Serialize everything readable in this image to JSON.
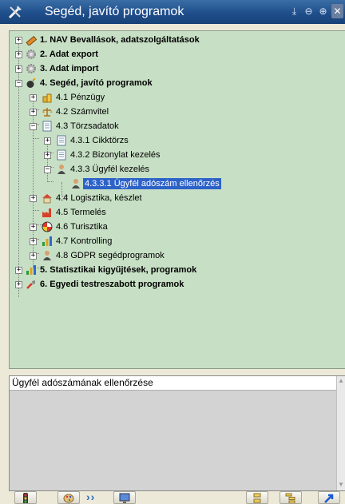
{
  "window": {
    "title": "Segéd, javító programok"
  },
  "tree": {
    "items": [
      {
        "label": "1. NAV Bevallások, adatszolgáltatások",
        "icon": "pen-icon"
      },
      {
        "label": "2. Adat export",
        "icon": "gear-icon"
      },
      {
        "label": "3. Adat import",
        "icon": "gear-icon"
      },
      {
        "label": "4. Segéd, javító programok",
        "icon": "bomb-icon"
      },
      {
        "label": "4.1 Pénzügy",
        "icon": "coins-icon"
      },
      {
        "label": "4.2 Számvitel",
        "icon": "scale-icon"
      },
      {
        "label": "4.3 Törzsadatok",
        "icon": "document-icon"
      },
      {
        "label": "4.3.1 Cikktörzs",
        "icon": "document-icon"
      },
      {
        "label": "4.3.2 Bizonylat kezelés",
        "icon": "document-icon"
      },
      {
        "label": "4.3.3 Ügyfél kezelés",
        "icon": "person-icon"
      },
      {
        "label": "4.3.3.1 Ügyfél adószám ellenőrzés",
        "icon": "person-icon"
      },
      {
        "label": "4.4 Logisztika, készlet",
        "icon": "warehouse-icon"
      },
      {
        "label": "4.5 Termelés",
        "icon": "factory-icon"
      },
      {
        "label": "4.6 Turisztika",
        "icon": "beach-ball-icon"
      },
      {
        "label": "4.7 Kontrolling",
        "icon": "bar-chart-icon"
      },
      {
        "label": "4.8 GDPR segédprogramok",
        "icon": "person-icon"
      },
      {
        "label": "5. Statisztikai kigyűjtések, programok",
        "icon": "bar-chart-icon"
      },
      {
        "label": "6. Egyedi testreszabott programok",
        "icon": "wrench-icon"
      }
    ],
    "selected_item": "4.3.3.1 Ügyfél adószám ellenőrzés"
  },
  "detail": {
    "description": "Ügyfél adószámának ellenőrzése"
  },
  "colors": {
    "tree_bg": "#c7e0c5",
    "selection": "#2d62c8",
    "titlebar": "#1f4e8c"
  }
}
